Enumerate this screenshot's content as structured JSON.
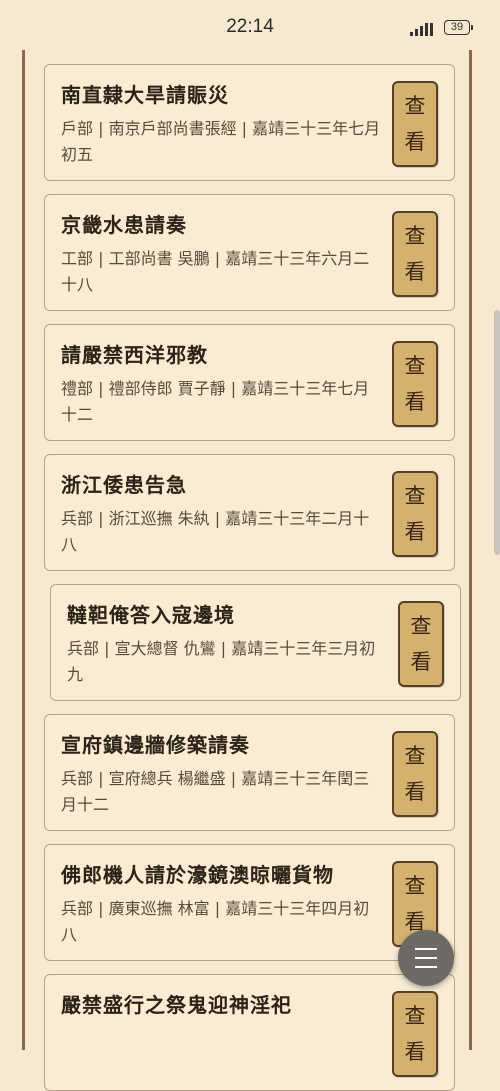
{
  "status_bar": {
    "time": "22:14",
    "battery": "39"
  },
  "view_label": "查看",
  "memorials": [
    {
      "title": "南直隸大旱請賑災",
      "meta": "戶部 | 南京戶部尚書張經 | 嘉靖三十三年七月初五"
    },
    {
      "title": "京畿水患請奏",
      "meta": "工部 | 工部尚書 吳鵬 | 嘉靖三十三年六月二十八"
    },
    {
      "title": "請嚴禁西洋邪教",
      "meta": "禮部 | 禮部侍郎 賈子靜 | 嘉靖三十三年七月十二"
    },
    {
      "title": "浙江倭患告急",
      "meta": "兵部 | 浙江巡撫 朱紈 | 嘉靖三十三年二月十八"
    },
    {
      "title": "韃靼俺答入寇邊境",
      "meta": "兵部 | 宣大總督 仇鸞 | 嘉靖三十三年三月初九"
    },
    {
      "title": "宣府鎮邊牆修築請奏",
      "meta": "兵部 | 宣府總兵 楊繼盛 | 嘉靖三十三年閏三月十二"
    },
    {
      "title": "佛郎機人請於濠鏡澳晾曬貨物",
      "meta": "兵部 | 廣東巡撫 林富 | 嘉靖三十三年四月初八"
    },
    {
      "title": "嚴禁盛行之祭鬼迎神淫祀",
      "meta": ""
    }
  ],
  "menu_icon": "hamburger-menu-icon"
}
